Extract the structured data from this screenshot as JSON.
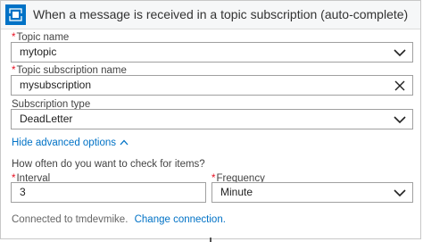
{
  "header": {
    "title": "When a message is received in a topic subscription (auto-complete)",
    "icon": "service-bus-icon"
  },
  "topic_name": {
    "label": "Topic name",
    "value": "mytopic",
    "required": "*"
  },
  "subscription_name": {
    "label": "Topic subscription name",
    "value": "mysubscription",
    "required": "*"
  },
  "subscription_type": {
    "label": "Subscription type",
    "value": "DeadLetter"
  },
  "advanced": {
    "label": "Hide advanced options"
  },
  "schedule": {
    "question": "How often do you want to check for items?",
    "interval_label": "Interval",
    "interval_value": "3",
    "frequency_label": "Frequency",
    "frequency_value": "Minute",
    "required": "*"
  },
  "footer": {
    "connected_text": "Connected to tmdevmike.",
    "change_link": "Change connection."
  },
  "colors": {
    "accent": "#0072c6",
    "required": "#e81123",
    "header_bg": "#f6f7f8"
  }
}
